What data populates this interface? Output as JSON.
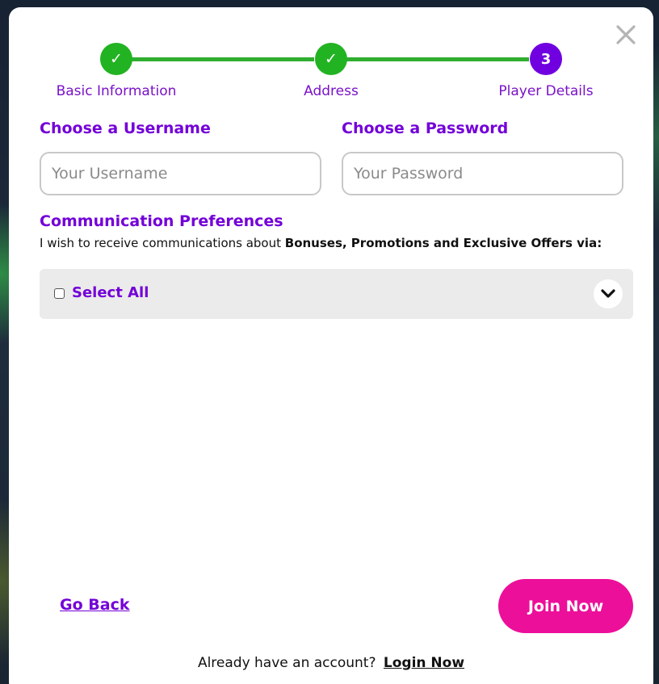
{
  "stepper": {
    "steps": [
      {
        "label": "Basic Information",
        "state": "done",
        "marker": "✓"
      },
      {
        "label": "Address",
        "state": "done",
        "marker": "✓"
      },
      {
        "label": "Player Details",
        "state": "current",
        "marker": "3"
      }
    ]
  },
  "form": {
    "username": {
      "label": "Choose a Username",
      "placeholder": "Your Username",
      "value": ""
    },
    "password": {
      "label": "Choose a Password",
      "placeholder": "Your Password",
      "value": ""
    }
  },
  "communication": {
    "title": "Communication Preferences",
    "desc_prefix": "I wish to receive communications about ",
    "desc_bold": "Bonuses, Promotions and Exclusive Offers via:",
    "select_all_label": "Select All",
    "select_all_checked": false
  },
  "actions": {
    "go_back_label": "Go Back",
    "join_label": "Join Now"
  },
  "footer": {
    "prompt": "Already have an account?",
    "login_label": "Login Now"
  },
  "colors": {
    "brand_purple": "#7300d8",
    "step_done_green": "#22b322",
    "step_current_purple": "#7000e0",
    "join_pink": "#ec0f9a"
  }
}
